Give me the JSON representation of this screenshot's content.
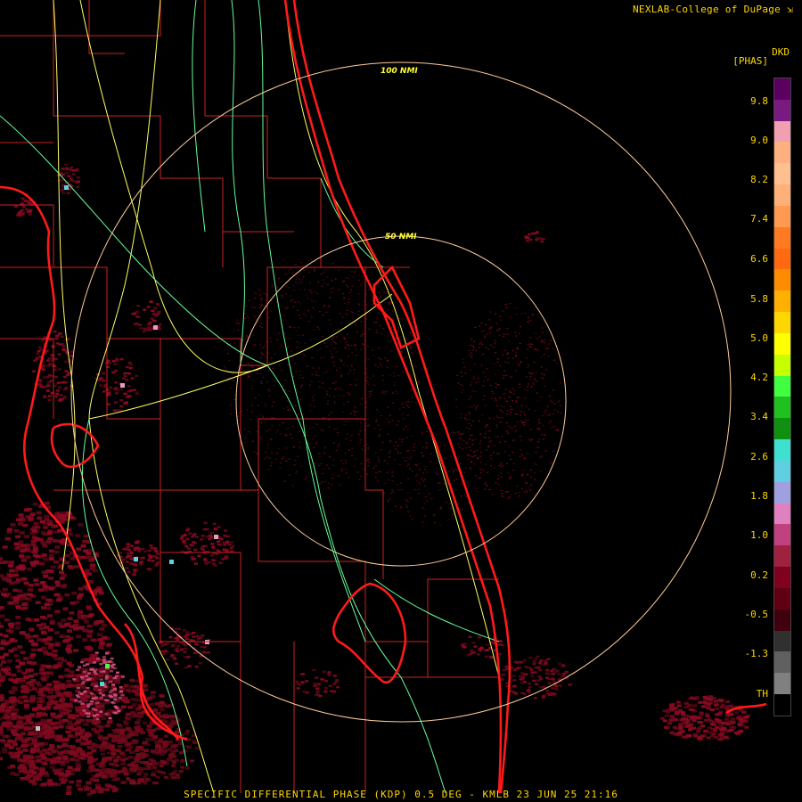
{
  "header": {
    "credit": "NEXLAB-College of DuPage"
  },
  "footer": {
    "caption": "SPECIFIC DIFFERENTIAL PHASE (KDP) 0.5 DEG - KMLB 23 JUN 25 21:16"
  },
  "rings": [
    {
      "label": "100 NMI"
    },
    {
      "label": "50 NMI"
    }
  ],
  "legend": {
    "unit_top": "DKD",
    "unit_sub": "[PHAS]",
    "ticks": [
      "9.8",
      "9.0",
      "8.2",
      "7.4",
      "6.6",
      "5.8",
      "5.0",
      "4.2",
      "3.4",
      "2.6",
      "1.8",
      "1.0",
      "0.2",
      "-0.5",
      "-1.3",
      "TH"
    ],
    "colors": [
      "#5b0060",
      "#7a1a80",
      "#f0a0b0",
      "#ffb080",
      "#ffc090",
      "#ffb078",
      "#ff9a50",
      "#ff7a20",
      "#ff6a10",
      "#ff8c00",
      "#ffb000",
      "#ffd700",
      "#ffff00",
      "#c8ff00",
      "#40ff40",
      "#20c020",
      "#109010",
      "#40e0d0",
      "#60d0e0",
      "#a0a0e0",
      "#e080c0",
      "#c04080",
      "#a02040",
      "#800020",
      "#600010",
      "#400010",
      "#303030",
      "#606060",
      "#808080",
      "#000000"
    ]
  },
  "colors": {
    "coast": "#ff1a1a",
    "county": "#cc2222",
    "highway": "#ffff66",
    "road": "#66ff99",
    "ring": "#ffcc99",
    "echo": "#8a0a1e"
  }
}
